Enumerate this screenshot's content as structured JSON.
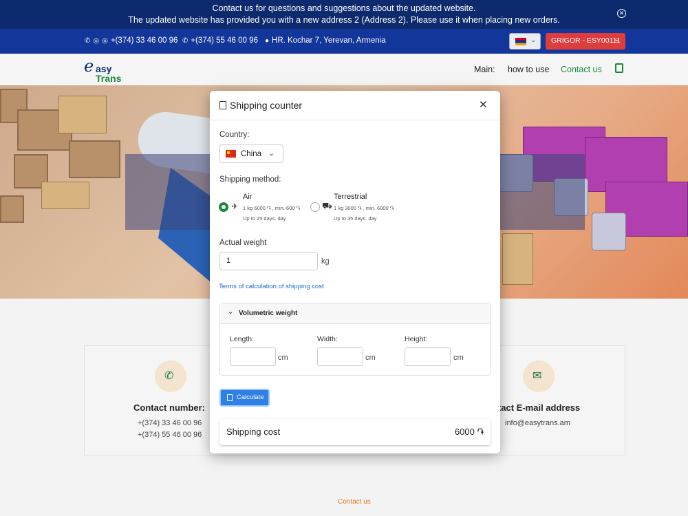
{
  "announcement": {
    "line1": "Contact us for questions and suggestions about the updated website.",
    "line2": "The updated website has provided you with a new address 2 (Address 2). Please use it when placing new orders."
  },
  "contact_bar": {
    "phone1": "+(374) 33 46 00 96",
    "phone2": "+(374) 55 46 00 96",
    "address": "HR. Kochar 7, Yerevan, Armenia",
    "user": "GRIGOR - ESY00111"
  },
  "nav": {
    "logo_e": "e",
    "logo_asy": "asy",
    "logo_trans": "Trans",
    "main": "Main:",
    "how_to_use": "how to use",
    "contact_us": "Contact us"
  },
  "contact_section": {
    "phone_title": "Contact number:",
    "phone1": "+(374) 33 46 00 96",
    "phone2": "+(374) 55 46 00 96",
    "email_title": "ntact E-mail address",
    "email": "info@easytrans.am",
    "footer_link": "Contact us"
  },
  "modal": {
    "title": "Shipping counter",
    "country_label": "Country:",
    "country_value": "China",
    "method_label": "Shipping method:",
    "methods": [
      {
        "name": "Air",
        "rate": "1 kg 6000 ֏ , min. 600 ֏",
        "days": "Up to 25 days. day",
        "selected": true
      },
      {
        "name": "Terrestrial",
        "rate": "1 kg 3000 ֏ , min. 6000 ֏",
        "days": "Up to 35 days. day",
        "selected": false
      }
    ],
    "weight_label": "Actual weight",
    "weight_value": "1",
    "weight_unit": "kg",
    "terms_link": "Terms of calculation of shipping cost",
    "volumetric_title": "Volumetric weight",
    "length_label": "Length:",
    "width_label": "Width:",
    "height_label": "Height:",
    "dim_unit": "cm",
    "calculate_label": "Calculate",
    "cost_label": "Shipping cost",
    "cost_value": "6000 ֏"
  },
  "colors": {
    "announce_bg": "#0d2a6e",
    "bar_bg": "#13369a",
    "accent_green": "#1a8a3a",
    "user_btn": "#dc3d3d",
    "calc_btn": "#2f7fe8",
    "link_blue": "#1a6bd0"
  }
}
